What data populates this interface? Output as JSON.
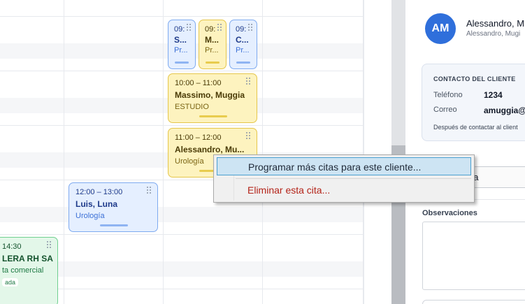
{
  "calendar": {
    "appointments": [
      {
        "time": "09:",
        "name": "S...",
        "service": "Pr...",
        "color": "blue"
      },
      {
        "time": "09:",
        "name": "M...",
        "service": "Pr...",
        "color": "yellow"
      },
      {
        "time": "09:",
        "name": "C...",
        "service": "Pr...",
        "color": "blue"
      },
      {
        "time": "10:00 – 11:00",
        "name": "Massimo, Muggia",
        "service": "ESTUDIO",
        "color": "yellow"
      },
      {
        "time": "11:00 – 12:00",
        "name": "Alessandro, Mu...",
        "service": "Urología",
        "color": "yellow"
      },
      {
        "time": "12:00 – 13:00",
        "name": "Luis, Luna",
        "service": "Urología",
        "color": "blue"
      },
      {
        "time": "14:30",
        "name": "LERA RH SA",
        "service": "ta comercial",
        "badge": "ada",
        "color": "green"
      }
    ]
  },
  "panel": {
    "avatar_initials": "AM",
    "client_name": "Alessandro, M",
    "client_sub": "Alessandro, Mugi",
    "contact": {
      "title": "CONTACTO DEL CLIENTE",
      "phone_label": "Teléfono",
      "phone_value": "1234",
      "email_label": "Correo",
      "email_value": "amuggia@",
      "note": "Después de contactar al client"
    },
    "action_button": "da",
    "observations_label": "Observaciones"
  },
  "context_menu": {
    "items": [
      {
        "label": "Programar más citas para este cliente...",
        "highlighted": true
      },
      {
        "label": "Eliminar esta cita...",
        "danger": true
      }
    ]
  },
  "colors": {
    "avatar": "#2f6fdb",
    "danger_text": "#b42318",
    "menu_highlight": "#cde4f3"
  }
}
